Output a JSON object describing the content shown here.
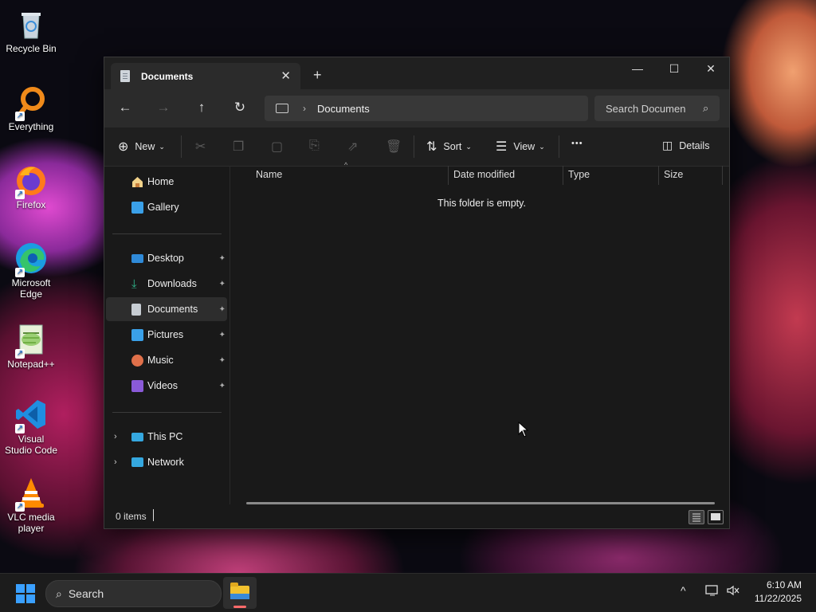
{
  "desktop": {
    "icons": [
      {
        "label": "Recycle Bin",
        "icon": "recycle-bin-icon"
      },
      {
        "label": "Everything",
        "icon": "everything-search-icon"
      },
      {
        "label": "Firefox",
        "icon": "firefox-icon"
      },
      {
        "label": "Microsoft Edge",
        "icon": "edge-icon"
      },
      {
        "label": "Notepad++",
        "icon": "notepadpp-icon"
      },
      {
        "label": "Visual Studio Code",
        "icon": "vscode-icon"
      },
      {
        "label": "VLC media player",
        "icon": "vlc-icon"
      }
    ]
  },
  "window": {
    "tab_title": "Documents",
    "tab_close": "✕",
    "new_tab": "+",
    "minimize": "—",
    "maximize": "☐",
    "close": "✕"
  },
  "navbar": {
    "back": "←",
    "forward": "→",
    "up": "↑",
    "refresh": "↻",
    "breadcrumb_sep": "›",
    "breadcrumb": "Documents",
    "search_placeholder": "Search Documents",
    "search_icon": "⌕"
  },
  "toolbar": {
    "new_label": "New",
    "sort_label": "Sort",
    "view_label": "View",
    "more_label": "•••",
    "details_label": "Details",
    "disabled_actions": [
      "cut",
      "copy",
      "paste",
      "rename",
      "share",
      "delete"
    ]
  },
  "nav_pane": {
    "quick": [
      {
        "label": "Home",
        "icon": "home-icon"
      },
      {
        "label": "Gallery",
        "icon": "gallery-icon"
      }
    ],
    "pinned": [
      {
        "label": "Desktop",
        "icon": "desktop-folder-icon",
        "color": "#2f8ad8"
      },
      {
        "label": "Downloads",
        "icon": "downloads-icon",
        "color": "#2fb48a"
      },
      {
        "label": "Documents",
        "icon": "documents-icon",
        "color": "#c7cdd3",
        "selected": true
      },
      {
        "label": "Pictures",
        "icon": "pictures-icon",
        "color": "#3aa0e8"
      },
      {
        "label": "Music",
        "icon": "music-icon",
        "color": "#e0704a"
      },
      {
        "label": "Videos",
        "icon": "videos-icon",
        "color": "#8a5ad8"
      }
    ],
    "bottom": [
      {
        "label": "This PC",
        "icon": "this-pc-icon",
        "color": "#35a8e0"
      },
      {
        "label": "Network",
        "icon": "network-icon",
        "color": "#35a8e0"
      }
    ],
    "pin_glyph": "📌",
    "expand_glyph": "›"
  },
  "columns": [
    "Name",
    "Date modified",
    "Type",
    "Size"
  ],
  "empty_message": "This folder is empty.",
  "status": {
    "items_text": "0 items"
  },
  "taskbar": {
    "search_label": "Search",
    "time": "6:10 AM",
    "date": "11/22/2025",
    "chevron": "^"
  },
  "colors": {
    "accent": "#3aa0ff",
    "window_bg": "#191919"
  }
}
